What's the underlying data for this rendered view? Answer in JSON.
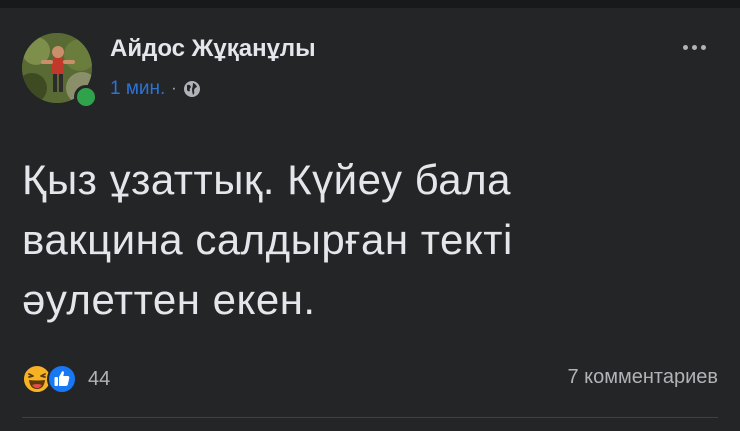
{
  "post": {
    "author": {
      "name": "Айдос Жұқанұлы",
      "online": true,
      "avatar_icon": "person-avatar"
    },
    "time": "1 мин.",
    "separator": "·",
    "privacy_icon": "globe-icon",
    "more_icon": "more-dots-icon",
    "text": "Қыз ұзаттық. Күйеу бала\nвакцина салдырған текті\nәулеттен екен.",
    "reactions": {
      "icons": [
        "haha-icon",
        "like-icon"
      ],
      "count": "44"
    },
    "comments": "7 комментариев"
  },
  "colors": {
    "background": "#242526",
    "text_primary": "#e4e6eb",
    "text_secondary": "#b0b3b8",
    "link_blue": "#2d73d6",
    "online_green": "#31a24c",
    "like_blue": "#1877f2",
    "haha_yellow": "#f7b125"
  }
}
